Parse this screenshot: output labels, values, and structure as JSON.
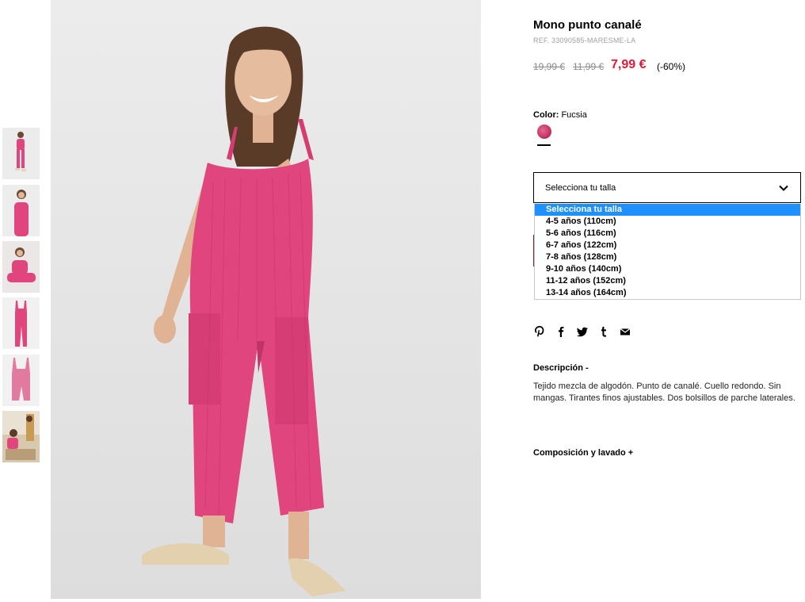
{
  "product": {
    "title": "Mono punto canalé",
    "ref": "REF. 33090585-MARESME-LA",
    "prices": {
      "original": "19,99 €",
      "previous": "11,99 €",
      "current": "7,99 €",
      "discount": "(-60%)"
    },
    "color": {
      "label": "Color:",
      "value": " Fucsia",
      "swatch_hex": "#c8326a"
    }
  },
  "size_select": {
    "placeholder": "Selecciona tu talla",
    "options": [
      "Selecciona tu talla",
      "4-5 años (110cm)",
      "5-6 años (116cm)",
      "6-7 años (122cm)",
      "7-8 años (128cm)",
      "9-10 años (140cm)",
      "11-12 años (152cm)",
      "13-14 años (164cm)"
    ],
    "highlight_hex": "#1e90ff"
  },
  "social": [
    "pinterest-icon",
    "facebook-icon",
    "twitter-icon",
    "tumblr-icon",
    "email-icon"
  ],
  "description": {
    "title": "Descripción -",
    "text": "Tejido mezcla de algodón. Punto de canalé. Cuello redondo. Sin mangas. Tirantes finos ajustables. Dos bolsillos de parche laterales."
  },
  "composition": {
    "title": "Composición y lavado +"
  },
  "colors": {
    "sale_price": "#e0193a",
    "garment": "#e0457d"
  }
}
